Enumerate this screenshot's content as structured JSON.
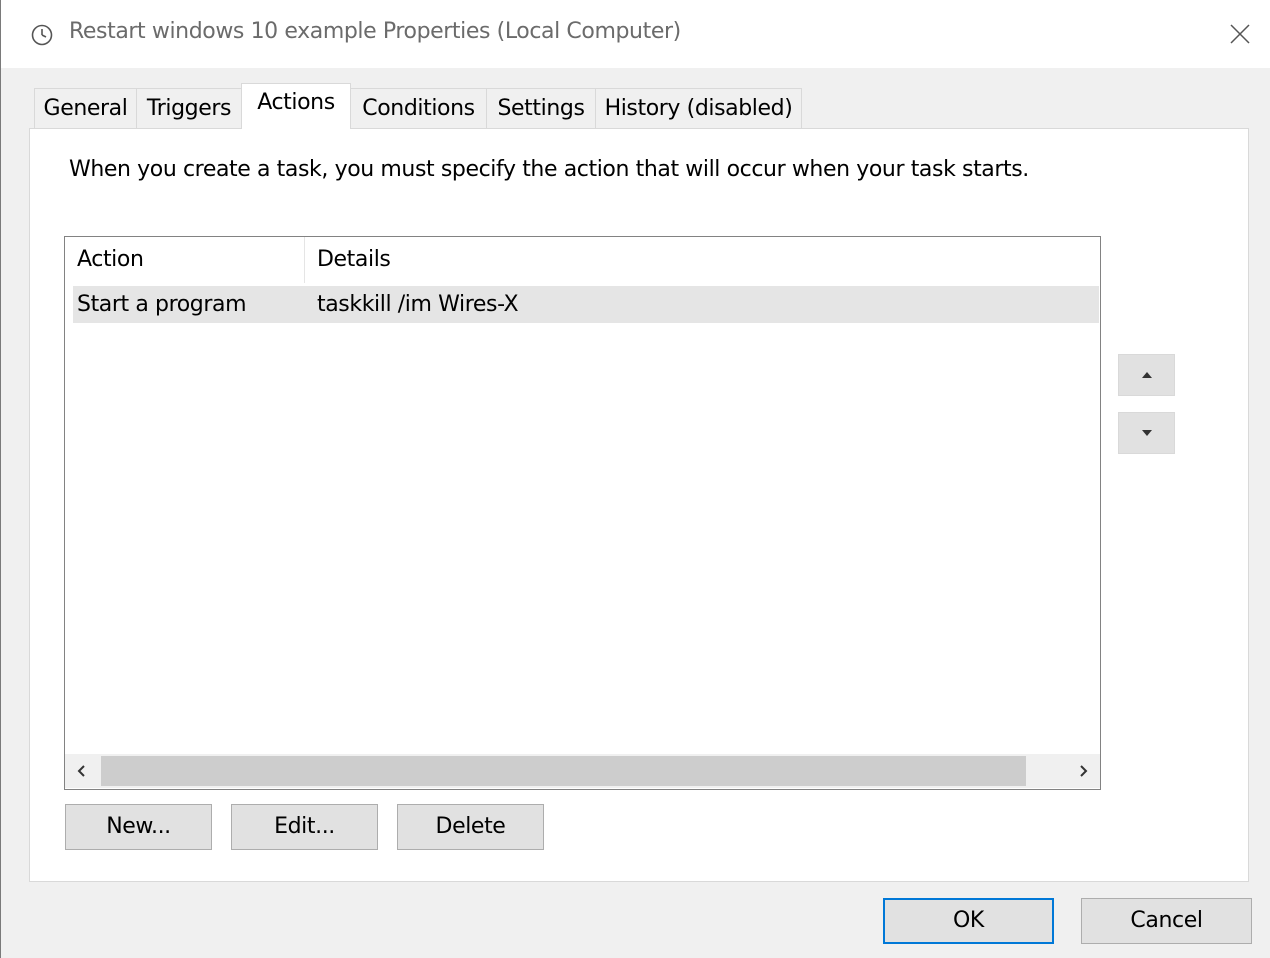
{
  "window": {
    "title": "Restart windows 10 example Properties (Local Computer)",
    "title_icon": "clock-icon",
    "close_icon": "close-icon"
  },
  "tabs": [
    {
      "label": "General",
      "active": false
    },
    {
      "label": "Triggers",
      "active": false
    },
    {
      "label": "Actions",
      "active": true
    },
    {
      "label": "Conditions",
      "active": false
    },
    {
      "label": "Settings",
      "active": false
    },
    {
      "label": "History (disabled)",
      "active": false
    }
  ],
  "actions_page": {
    "instruction": "When you create a task, you must specify the action that will occur when your task starts.",
    "columns": [
      "Action",
      "Details"
    ],
    "rows": [
      {
        "action": "Start a program",
        "details": "taskkill /im Wires-X",
        "selected": true
      }
    ],
    "move_up_icon": "triangle-up-icon",
    "move_down_icon": "triangle-down-icon",
    "buttons": {
      "new": "New...",
      "edit": "Edit...",
      "delete": "Delete"
    }
  },
  "footer": {
    "ok": "OK",
    "cancel": "Cancel"
  },
  "colors": {
    "accent": "#0078d7",
    "selection": "#e5e5e5",
    "button_face": "#e1e1e1"
  }
}
